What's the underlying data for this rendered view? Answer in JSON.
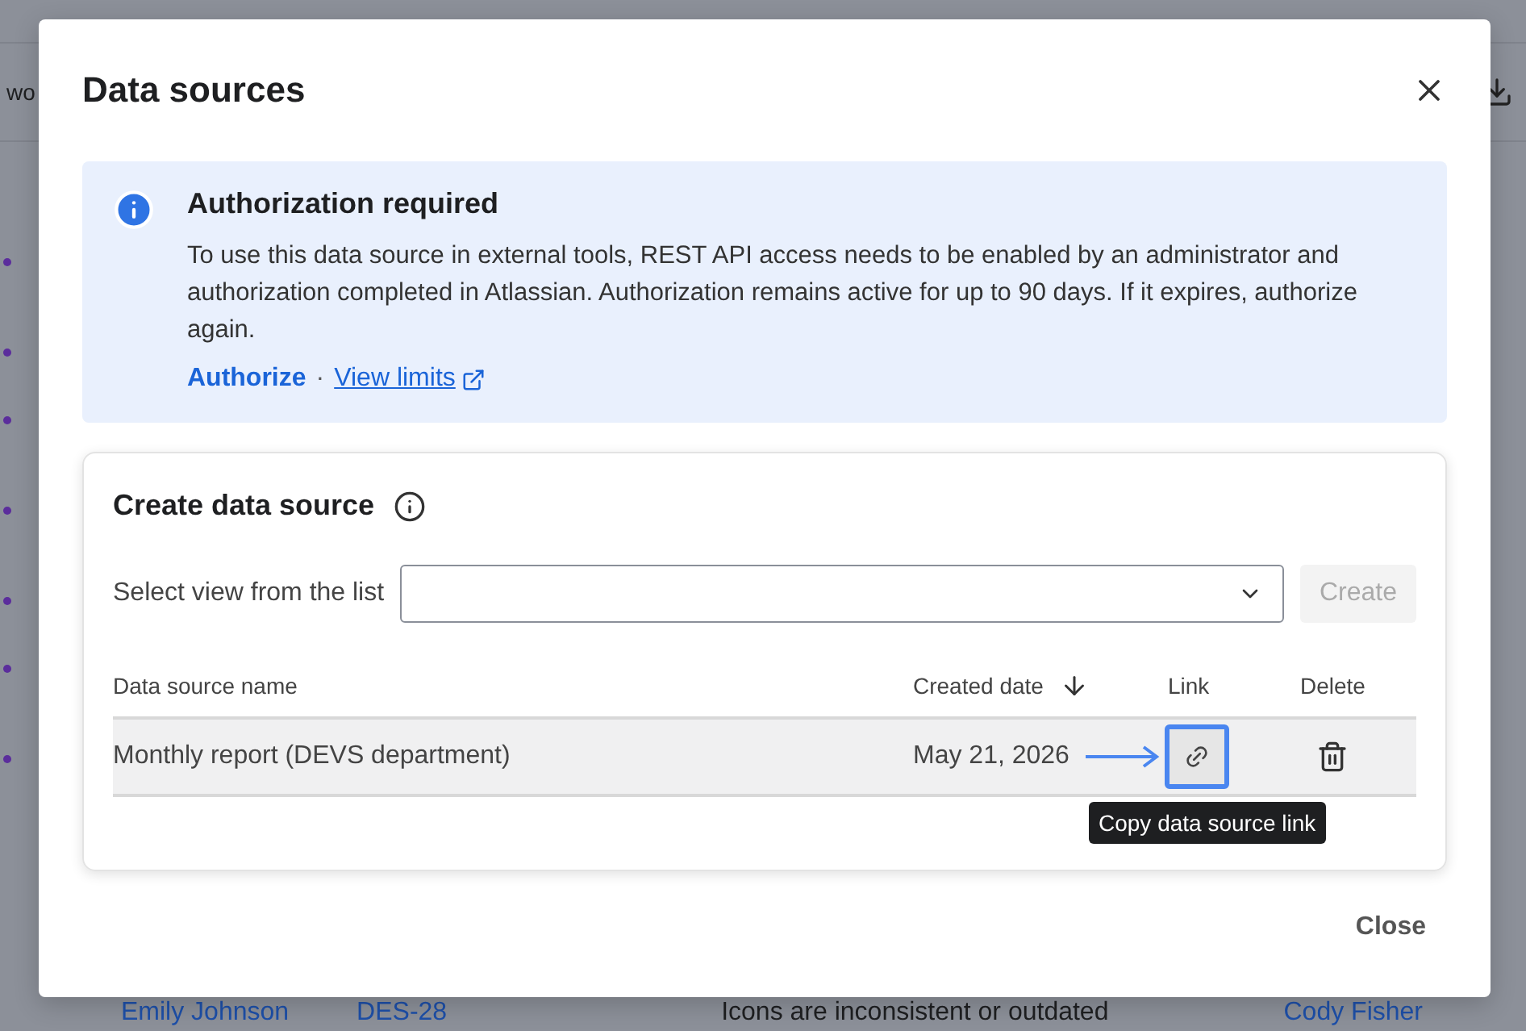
{
  "background": {
    "toolbar_text": "wo",
    "bottom_row": {
      "assignee": "Emily Johnson",
      "key": "DES-28",
      "summary": "Icons are inconsistent or outdated",
      "reporter": "Cody Fisher"
    }
  },
  "dialog": {
    "title": "Data sources",
    "notice": {
      "title": "Authorization required",
      "body": "To use this data source in external tools, REST API access needs to be enabled by an administrator and authorization completed in Atlassian. Authorization remains active for up to 90 days. If it expires, authorize again.",
      "action": "Authorize",
      "separator": "·",
      "link": "View limits"
    },
    "create": {
      "title": "Create data source",
      "select_label": "Select view from the list",
      "create_button": {
        "label": "Create",
        "disabled": true
      }
    },
    "table": {
      "columns": [
        "Data source name",
        "Created date",
        "Link",
        "Delete"
      ],
      "rows": [
        {
          "name": "Monthly report (DEVS department)",
          "created": "May 21, 2026",
          "highlighted": true
        }
      ]
    },
    "tooltip": "Copy data source link",
    "close_button": "Close"
  }
}
